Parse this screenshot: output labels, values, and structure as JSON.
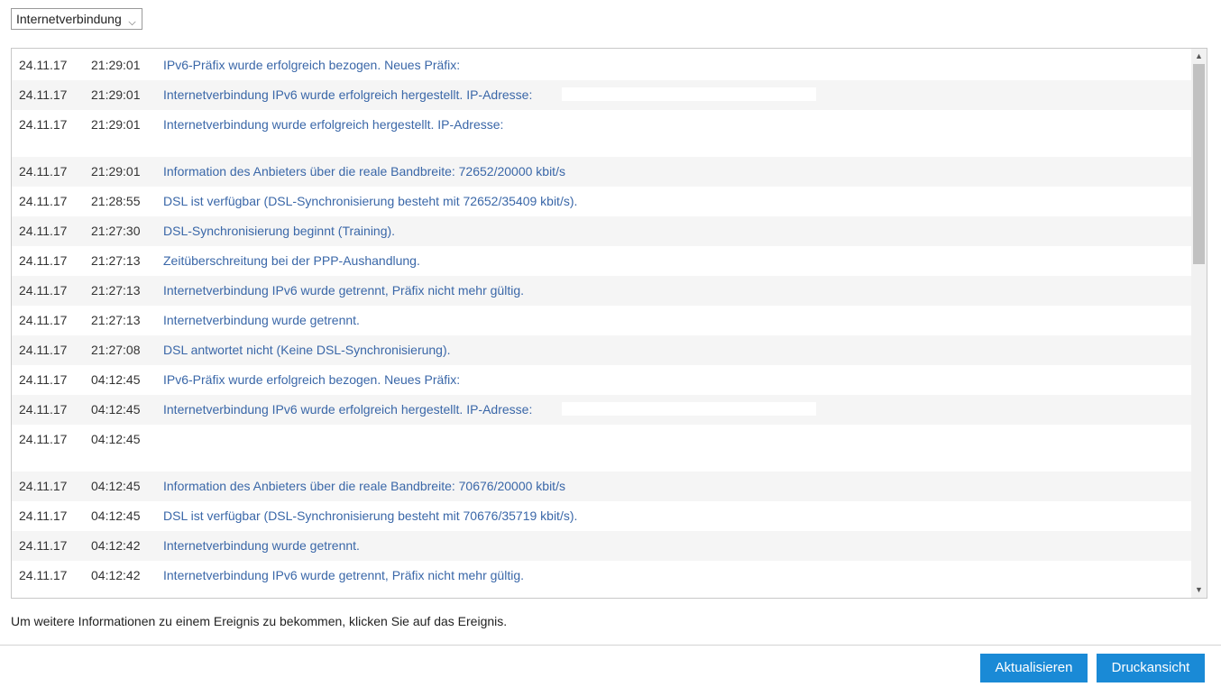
{
  "filter": {
    "selected": "Internetverbindung",
    "chevron_glyph": "⌵"
  },
  "events": [
    {
      "date": "24.11.17",
      "time": "21:29:01",
      "message": "IPv6-Präfix wurde erfolgreich bezogen. Neues Präfix:"
    },
    {
      "date": "24.11.17",
      "time": "21:29:01",
      "message": "Internetverbindung IPv6 wurde erfolgreich hergestellt. IP-Adresse:"
    },
    {
      "date": "24.11.17",
      "time": "21:29:01",
      "message": "Internetverbindung wurde erfolgreich hergestellt. IP-Adresse:"
    },
    {
      "date": "24.11.17",
      "time": "21:29:01",
      "message": "Information des Anbieters über die reale Bandbreite: 72652/20000 kbit/s"
    },
    {
      "date": "24.11.17",
      "time": "21:28:55",
      "message": "DSL ist verfügbar (DSL-Synchronisierung besteht mit 72652/35409 kbit/s)."
    },
    {
      "date": "24.11.17",
      "time": "21:27:30",
      "message": "DSL-Synchronisierung beginnt (Training)."
    },
    {
      "date": "24.11.17",
      "time": "21:27:13",
      "message": "Zeitüberschreitung bei der PPP-Aushandlung."
    },
    {
      "date": "24.11.17",
      "time": "21:27:13",
      "message": "Internetverbindung IPv6 wurde getrennt, Präfix nicht mehr gültig."
    },
    {
      "date": "24.11.17",
      "time": "21:27:13",
      "message": "Internetverbindung wurde getrennt."
    },
    {
      "date": "24.11.17",
      "time": "21:27:08",
      "message": "DSL antwortet nicht (Keine DSL-Synchronisierung)."
    },
    {
      "date": "24.11.17",
      "time": "04:12:45",
      "message": "IPv6-Präfix wurde erfolgreich bezogen. Neues Präfix:"
    },
    {
      "date": "24.11.17",
      "time": "04:12:45",
      "message": "Internetverbindung IPv6 wurde erfolgreich hergestellt. IP-Adresse:"
    },
    {
      "date": "24.11.17",
      "time": "04:12:45",
      "message": ""
    },
    {
      "date": "24.11.17",
      "time": "04:12:45",
      "message": "Information des Anbieters über die reale Bandbreite: 70676/20000 kbit/s"
    },
    {
      "date": "24.11.17",
      "time": "04:12:45",
      "message": "DSL ist verfügbar (DSL-Synchronisierung besteht mit 70676/35719 kbit/s)."
    },
    {
      "date": "24.11.17",
      "time": "04:12:42",
      "message": "Internetverbindung wurde getrennt."
    },
    {
      "date": "24.11.17",
      "time": "04:12:42",
      "message": "Internetverbindung IPv6 wurde getrennt, Präfix nicht mehr gültig."
    }
  ],
  "scrollbar": {
    "up_glyph": "▲",
    "down_glyph": "▼",
    "position_fraction": 0.0
  },
  "hint_text": "Um weitere Informationen zu einem Ereignis zu bekommen, klicken Sie auf das Ereignis.",
  "buttons": {
    "refresh_label": "Aktualisieren",
    "print_label": "Druckansicht"
  },
  "colors": {
    "message_link": "#3a67a8",
    "button_bg": "#1a8ad6",
    "row_alt_bg": "#f5f5f5"
  }
}
